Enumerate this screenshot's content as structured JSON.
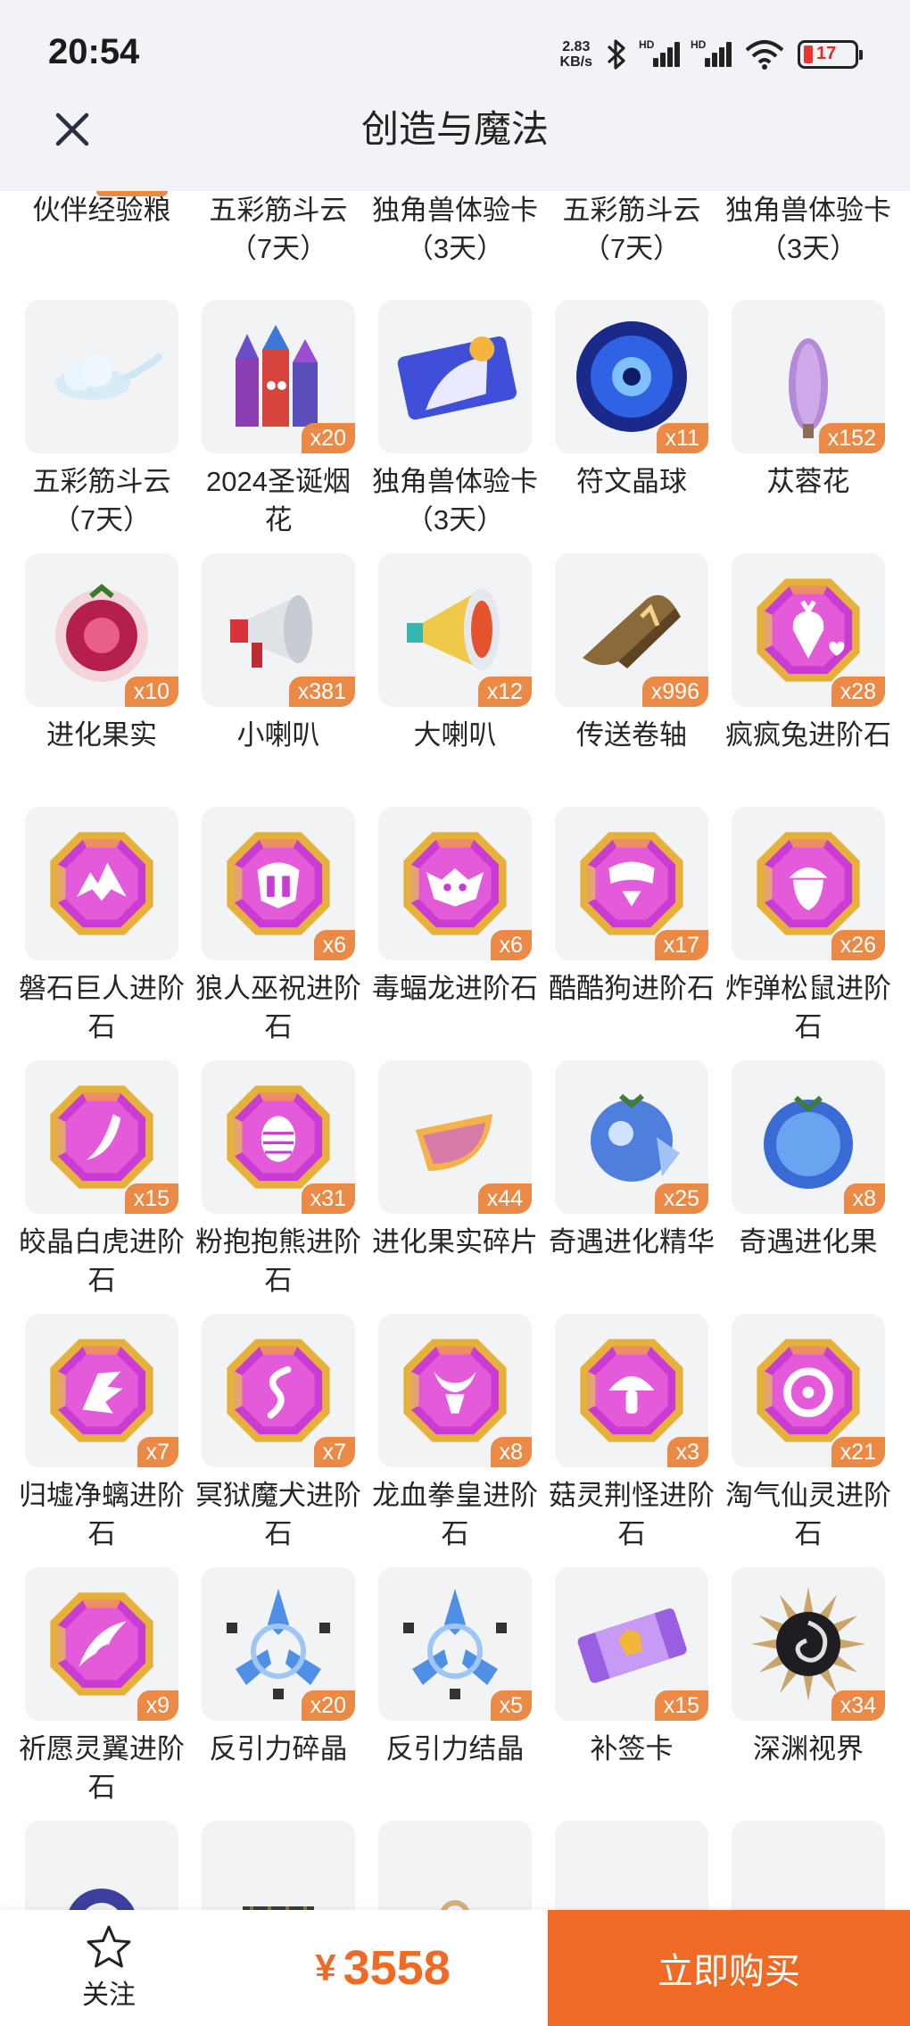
{
  "status_bar": {
    "time": "20:54",
    "net_speed_value": "2.83",
    "net_speed_unit": "KB/s",
    "hd_label": "HD",
    "battery": "17"
  },
  "header": {
    "title": "创造与魔法",
    "close_icon": "close-icon"
  },
  "colors": {
    "accent": "#ef6a24",
    "badge": "#ea8a46",
    "tile_bg": "#f2f3f5",
    "header_bg": "#f1f3f6"
  },
  "items": [
    {
      "name": "伙伴经验粮",
      "qty": "",
      "icon": "orange-tag"
    },
    {
      "name": "五彩筋斗云（7天）",
      "qty": "",
      "icon": "none"
    },
    {
      "name": "独角兽体验卡（3天）",
      "qty": "",
      "icon": "none"
    },
    {
      "name": "五彩筋斗云（7天）",
      "qty": "",
      "icon": "none"
    },
    {
      "name": "独角兽体验卡（3天）",
      "qty": "",
      "icon": "none"
    },
    {
      "name": "五彩筋斗云（7天）",
      "qty": "",
      "icon": "cloud"
    },
    {
      "name": "2024圣诞烟花",
      "qty": "x20",
      "icon": "fireworks"
    },
    {
      "name": "独角兽体验卡（3天）",
      "qty": "",
      "icon": "unicorn-card"
    },
    {
      "name": "符文晶球",
      "qty": "x11",
      "icon": "rune-orb"
    },
    {
      "name": "苁蓉花",
      "qty": "x152",
      "icon": "cistanche"
    },
    {
      "name": "进化果实",
      "qty": "x10",
      "icon": "berry"
    },
    {
      "name": "小喇叭",
      "qty": "x381",
      "icon": "megaphone-small"
    },
    {
      "name": "大喇叭",
      "qty": "x12",
      "icon": "megaphone-big"
    },
    {
      "name": "传送卷轴",
      "qty": "x996",
      "icon": "scroll"
    },
    {
      "name": "疯疯兔进阶石",
      "qty": "x28",
      "icon": "gem-carrot"
    },
    {
      "name": "磐石巨人进阶石",
      "qty": "",
      "icon": "gem-rock"
    },
    {
      "name": "狼人巫祝进阶石",
      "qty": "x6",
      "icon": "gem-mask"
    },
    {
      "name": "毒蝠龙进阶石",
      "qty": "x6",
      "icon": "gem-bat"
    },
    {
      "name": "酷酷狗进阶石",
      "qty": "x17",
      "icon": "gem-dog"
    },
    {
      "name": "炸弹松鼠进阶石",
      "qty": "x26",
      "icon": "gem-acorn"
    },
    {
      "name": "皎晶白虎进阶石",
      "qty": "x15",
      "icon": "gem-fang"
    },
    {
      "name": "粉抱抱熊进阶石",
      "qty": "x31",
      "icon": "gem-egg"
    },
    {
      "name": "进化果实碎片",
      "qty": "x44",
      "icon": "fruit-slice"
    },
    {
      "name": "奇遇进化精华",
      "qty": "x25",
      "icon": "blue-fruit-shards"
    },
    {
      "name": "奇遇进化果",
      "qty": "x8",
      "icon": "blue-fruit"
    },
    {
      "name": "归墟净螭进阶石",
      "qty": "x7",
      "icon": "gem-wing"
    },
    {
      "name": "冥狱魔犬进阶石",
      "qty": "x7",
      "icon": "gem-flame"
    },
    {
      "name": "龙血拳皇进阶石",
      "qty": "x8",
      "icon": "gem-horns"
    },
    {
      "name": "菇灵荆怪进阶石",
      "qty": "x3",
      "icon": "gem-mushroom"
    },
    {
      "name": "淘气仙灵进阶石",
      "qty": "x21",
      "icon": "gem-ring"
    },
    {
      "name": "祈愿灵翼进阶石",
      "qty": "x9",
      "icon": "gem-feather"
    },
    {
      "name": "反引力碎晶",
      "qty": "x20",
      "icon": "crystal-shard"
    },
    {
      "name": "反引力结晶",
      "qty": "x5",
      "icon": "crystal"
    },
    {
      "name": "补签卡",
      "qty": "x15",
      "icon": "ticket"
    },
    {
      "name": "深渊视界",
      "qty": "x34",
      "icon": "abyss-eye"
    },
    {
      "name": "",
      "qty": "",
      "icon": "eye-creature"
    },
    {
      "name": "",
      "qty": "",
      "icon": "cage"
    },
    {
      "name": "",
      "qty": "",
      "icon": "key"
    },
    {
      "name": "",
      "qty": "",
      "icon": "winged-helm"
    },
    {
      "name": "",
      "qty": "",
      "icon": "red-heart-gem"
    }
  ],
  "bottom_bar": {
    "follow_label": "关注",
    "currency": "¥",
    "price": "3558",
    "buy_label": "立即购买"
  }
}
